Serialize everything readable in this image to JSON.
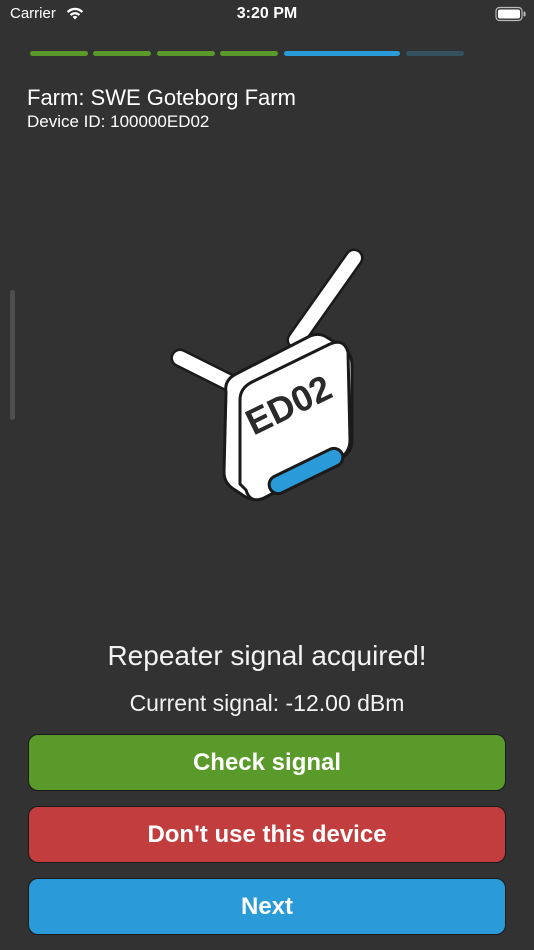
{
  "status_bar": {
    "carrier": "Carrier",
    "time": "3:20 PM",
    "wifi_icon": "wifi-icon",
    "battery_icon": "battery-icon"
  },
  "progress": {
    "total_steps": 6,
    "completed_steps": 4,
    "current_step": 5,
    "completed_color": "#5a9a2a",
    "current_color": "#2a9bd8",
    "pending_color": "#33525e"
  },
  "header": {
    "farm": "Farm: SWE Goteborg Farm",
    "device_id": "Device ID: 100000ED02"
  },
  "device": {
    "label": "ED02",
    "icon": "repeater-device-icon",
    "led_color": "#2a9bd8"
  },
  "messages": {
    "status": "Repeater signal acquired!",
    "signal": "Current signal: -12.00 dBm"
  },
  "buttons": {
    "check_signal": "Check signal",
    "dont_use": "Don't use this device",
    "next": "Next"
  },
  "colors": {
    "background": "#323232",
    "check_signal": "#5a9a2a",
    "dont_use": "#c23e3e",
    "next": "#2a9bd8"
  }
}
